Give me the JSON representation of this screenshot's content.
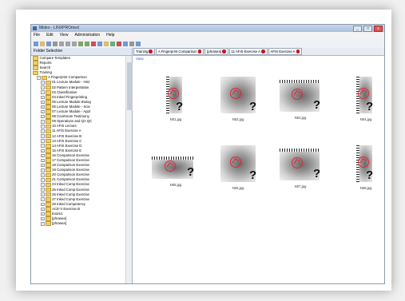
{
  "window": {
    "title": "Mideo - LINXPROmed",
    "controls": [
      "_",
      "□",
      "x"
    ]
  },
  "menu": [
    "File",
    "Edit",
    "View",
    "Administration",
    "Help"
  ],
  "toolbar": {
    "icons": [
      "new-icon",
      "open-icon",
      "save-icon",
      "print-icon",
      "cut-icon",
      "copy-icon",
      "paste-icon",
      "undo-icon",
      "redo-icon",
      "delete-icon",
      "zoom-icon",
      "color-icon",
      "grid-icon",
      "compare-icon",
      "report-icon",
      "settings-icon",
      "help-icon"
    ]
  },
  "sidebar": {
    "header": "Folder Selection",
    "tree": [
      {
        "label": "Compare Templates",
        "level": 0
      },
      {
        "label": "Reports",
        "level": 0
      },
      {
        "label": "Search",
        "level": 0
      },
      {
        "label": "Training",
        "level": 0
      },
      {
        "label": "A Fingerprint Comparison",
        "level": 1
      },
      {
        "label": "01 Lecture Module - Hist",
        "level": 2
      },
      {
        "label": "02 Pattern Interpretation",
        "level": 2
      },
      {
        "label": "03 Classification",
        "level": 2
      },
      {
        "label": "04 Inked Fingerprinting",
        "level": 2
      },
      {
        "label": "05 Lecture Module Biolog",
        "level": 2
      },
      {
        "label": "06 Lecture Module - Scie",
        "level": 2
      },
      {
        "label": "07 Lecture Module - Appl",
        "level": 2
      },
      {
        "label": "08 Courtroom Testimony",
        "level": 2
      },
      {
        "label": "09 Operations and QA QC",
        "level": 2
      },
      {
        "label": "10 AFIS Lecture",
        "level": 2
      },
      {
        "label": "11 AFIS Exercise A",
        "level": 2
      },
      {
        "label": "12 AFIS Exercise B",
        "level": 2
      },
      {
        "label": "13 AFIS Exercise C",
        "level": 2
      },
      {
        "label": "14 AFIS Exercise D",
        "level": 2
      },
      {
        "label": "15 AFIS Exercise E",
        "level": 2
      },
      {
        "label": "16 Comparison Exercise",
        "level": 2
      },
      {
        "label": "17 Comparison Exercise",
        "level": 2
      },
      {
        "label": "18 Comparison Exercise",
        "level": 2
      },
      {
        "label": "19 Comparison Exercise",
        "level": 2
      },
      {
        "label": "20 Comparison Exercise",
        "level": 2
      },
      {
        "label": "21 Comparison Exercise",
        "level": 2
      },
      {
        "label": "24 Inked Comp Exercise",
        "level": 2
      },
      {
        "label": "25 Inked Comp Exercise",
        "level": 2
      },
      {
        "label": "26 Inked Comp Exercise",
        "level": 2
      },
      {
        "label": "27 Inked Comp Exercise",
        "level": 2
      },
      {
        "label": "28 Inked Competency",
        "level": 2
      },
      {
        "label": "ACE-V Exercise B",
        "level": 2
      },
      {
        "label": "Exam1",
        "level": 2
      },
      {
        "label": "[phrasea]",
        "level": 2
      },
      {
        "label": "[phrasea]",
        "level": 2
      }
    ]
  },
  "tabs": [
    {
      "label": "Training"
    },
    {
      "label": "A Fingerprint Comparison"
    },
    {
      "label": "[phrasea]"
    },
    {
      "label": "11 AFIS Exercise A"
    },
    {
      "label": "AFIS Exercise A"
    }
  ],
  "main": {
    "view_link": "View",
    "thumbnails": [
      {
        "caption": "N01.jpg",
        "style": "ruler-left"
      },
      {
        "caption": "N02.jpg",
        "style": "plain"
      },
      {
        "caption": "N03.jpg",
        "style": "ruler-top"
      },
      {
        "caption": "N04.jpg",
        "style": "ruler-left"
      },
      {
        "caption": "N05.jpg",
        "style": "ruler-top"
      },
      {
        "caption": "N06.jpg",
        "style": "plain"
      },
      {
        "caption": "N07.jpg",
        "style": "ruler-top"
      },
      {
        "caption": "N08.jpg",
        "style": "ruler-left"
      }
    ]
  },
  "colors": {
    "accent_red": "#e0283a",
    "tab_close": "#c8141c",
    "folder": "#f0cf64"
  }
}
